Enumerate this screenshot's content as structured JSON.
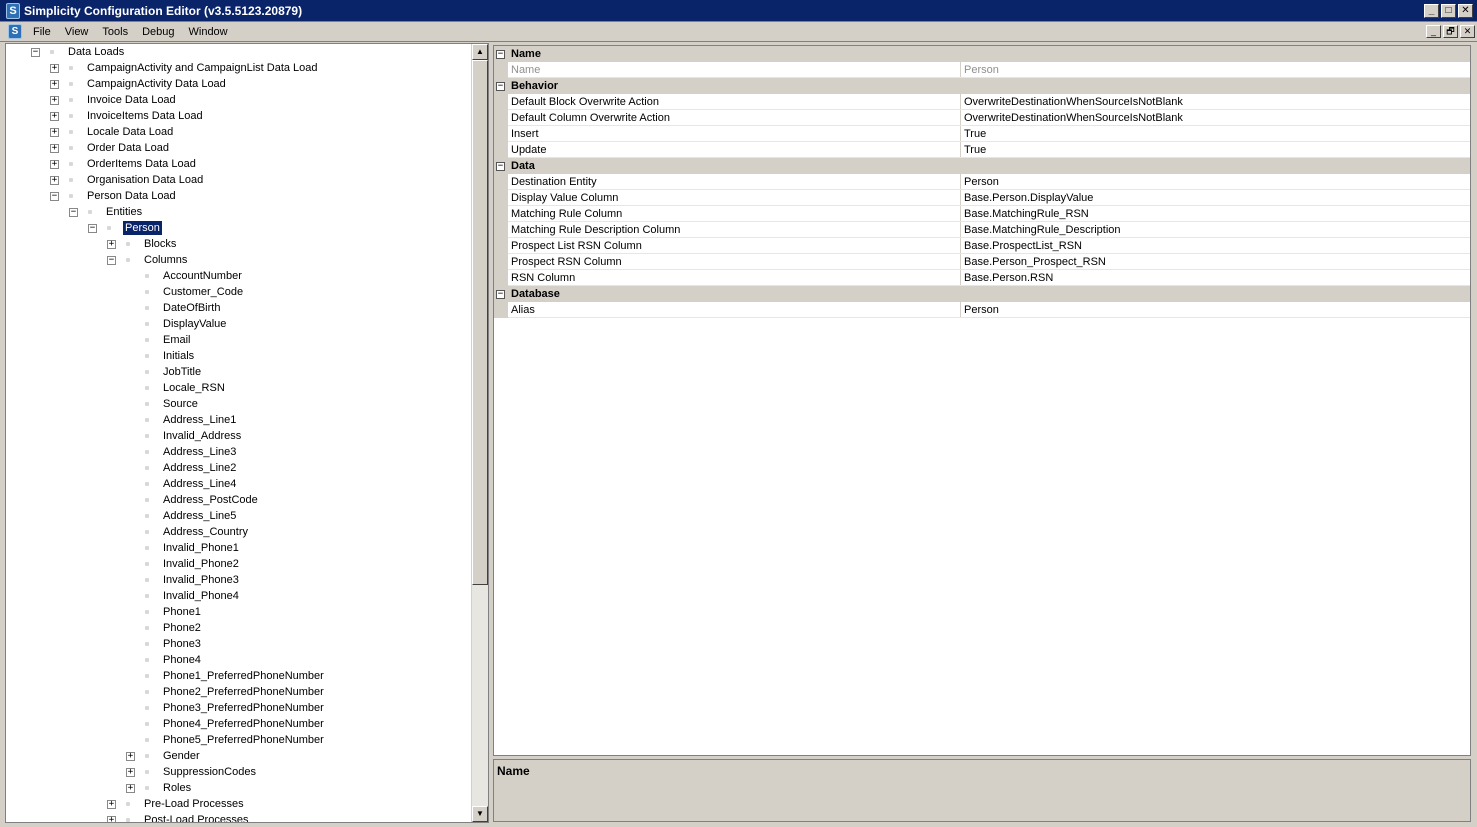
{
  "window": {
    "title": "Simplicity Configuration Editor (v3.5.5123.20879)",
    "app_icon": "S",
    "buttons": [
      "_",
      "□",
      "✕"
    ]
  },
  "menu": {
    "items": [
      "File",
      "View",
      "Tools",
      "Debug",
      "Window"
    ],
    "mdi_buttons": [
      "_",
      "🗗",
      "✕"
    ]
  },
  "tree": {
    "nodes": [
      {
        "label": "Data Loads",
        "level": 0,
        "exp": "−"
      },
      {
        "label": "CampaignActivity and CampaignList Data Load",
        "level": 1,
        "exp": "+"
      },
      {
        "label": "CampaignActivity Data Load",
        "level": 1,
        "exp": "+"
      },
      {
        "label": "Invoice Data Load",
        "level": 1,
        "exp": "+"
      },
      {
        "label": "InvoiceItems Data Load",
        "level": 1,
        "exp": "+"
      },
      {
        "label": "Locale Data Load",
        "level": 1,
        "exp": "+"
      },
      {
        "label": "Order Data Load",
        "level": 1,
        "exp": "+"
      },
      {
        "label": "OrderItems Data Load",
        "level": 1,
        "exp": "+"
      },
      {
        "label": "Organisation Data Load",
        "level": 1,
        "exp": "+"
      },
      {
        "label": "Person Data Load",
        "level": 1,
        "exp": "−"
      },
      {
        "label": "Entities",
        "level": 2,
        "exp": "−"
      },
      {
        "label": "Person",
        "level": 3,
        "exp": "−",
        "selected": true
      },
      {
        "label": "Blocks",
        "level": 4,
        "exp": "+"
      },
      {
        "label": "Columns",
        "level": 4,
        "exp": "−"
      },
      {
        "label": "AccountNumber",
        "level": 5,
        "exp": ""
      },
      {
        "label": "Customer_Code",
        "level": 5,
        "exp": ""
      },
      {
        "label": "DateOfBirth",
        "level": 5,
        "exp": ""
      },
      {
        "label": "DisplayValue",
        "level": 5,
        "exp": ""
      },
      {
        "label": "Email",
        "level": 5,
        "exp": ""
      },
      {
        "label": "Initials",
        "level": 5,
        "exp": ""
      },
      {
        "label": "JobTitle",
        "level": 5,
        "exp": ""
      },
      {
        "label": "Locale_RSN",
        "level": 5,
        "exp": ""
      },
      {
        "label": "Source",
        "level": 5,
        "exp": ""
      },
      {
        "label": "Address_Line1",
        "level": 5,
        "exp": ""
      },
      {
        "label": "Invalid_Address",
        "level": 5,
        "exp": ""
      },
      {
        "label": "Address_Line3",
        "level": 5,
        "exp": ""
      },
      {
        "label": "Address_Line2",
        "level": 5,
        "exp": ""
      },
      {
        "label": "Address_Line4",
        "level": 5,
        "exp": ""
      },
      {
        "label": "Address_PostCode",
        "level": 5,
        "exp": ""
      },
      {
        "label": "Address_Line5",
        "level": 5,
        "exp": ""
      },
      {
        "label": "Address_Country",
        "level": 5,
        "exp": ""
      },
      {
        "label": "Invalid_Phone1",
        "level": 5,
        "exp": ""
      },
      {
        "label": "Invalid_Phone2",
        "level": 5,
        "exp": ""
      },
      {
        "label": "Invalid_Phone3",
        "level": 5,
        "exp": ""
      },
      {
        "label": "Invalid_Phone4",
        "level": 5,
        "exp": ""
      },
      {
        "label": "Phone1",
        "level": 5,
        "exp": ""
      },
      {
        "label": "Phone2",
        "level": 5,
        "exp": ""
      },
      {
        "label": "Phone3",
        "level": 5,
        "exp": ""
      },
      {
        "label": "Phone4",
        "level": 5,
        "exp": ""
      },
      {
        "label": "Phone1_PreferredPhoneNumber",
        "level": 5,
        "exp": ""
      },
      {
        "label": "Phone2_PreferredPhoneNumber",
        "level": 5,
        "exp": ""
      },
      {
        "label": "Phone3_PreferredPhoneNumber",
        "level": 5,
        "exp": ""
      },
      {
        "label": "Phone4_PreferredPhoneNumber",
        "level": 5,
        "exp": ""
      },
      {
        "label": "Phone5_PreferredPhoneNumber",
        "level": 5,
        "exp": ""
      },
      {
        "label": "Gender",
        "level": 5,
        "exp": "+"
      },
      {
        "label": "SuppressionCodes",
        "level": 5,
        "exp": "+"
      },
      {
        "label": "Roles",
        "level": 5,
        "exp": "+"
      },
      {
        "label": "Pre-Load Processes",
        "level": 4,
        "exp": "+"
      },
      {
        "label": "Post-Load Processes",
        "level": 4,
        "exp": "+"
      }
    ]
  },
  "properties": {
    "rows": [
      {
        "type": "category",
        "label": "Name"
      },
      {
        "type": "item",
        "name": "Name",
        "value": "Person",
        "readonly": true
      },
      {
        "type": "category",
        "label": "Behavior"
      },
      {
        "type": "item",
        "name": "Default Block Overwrite Action",
        "value": "OverwriteDestinationWhenSourceIsNotBlank"
      },
      {
        "type": "item",
        "name": "Default Column Overwrite Action",
        "value": "OverwriteDestinationWhenSourceIsNotBlank"
      },
      {
        "type": "item",
        "name": "Insert",
        "value": "True"
      },
      {
        "type": "item",
        "name": "Update",
        "value": "True"
      },
      {
        "type": "category",
        "label": "Data"
      },
      {
        "type": "item",
        "name": "Destination Entity",
        "value": "Person"
      },
      {
        "type": "item",
        "name": "Display Value Column",
        "value": "Base.Person.DisplayValue"
      },
      {
        "type": "item",
        "name": "Matching Rule Column",
        "value": "Base.MatchingRule_RSN"
      },
      {
        "type": "item",
        "name": "Matching Rule Description Column",
        "value": "Base.MatchingRule_Description"
      },
      {
        "type": "item",
        "name": "Prospect List RSN Column",
        "value": "Base.ProspectList_RSN"
      },
      {
        "type": "item",
        "name": "Prospect RSN Column",
        "value": "Base.Person_Prospect_RSN"
      },
      {
        "type": "item",
        "name": "RSN Column",
        "value": "Base.Person.RSN"
      },
      {
        "type": "category",
        "label": "Database"
      },
      {
        "type": "item",
        "name": "Alias",
        "value": "Person"
      }
    ]
  },
  "description": {
    "title": "Name"
  }
}
